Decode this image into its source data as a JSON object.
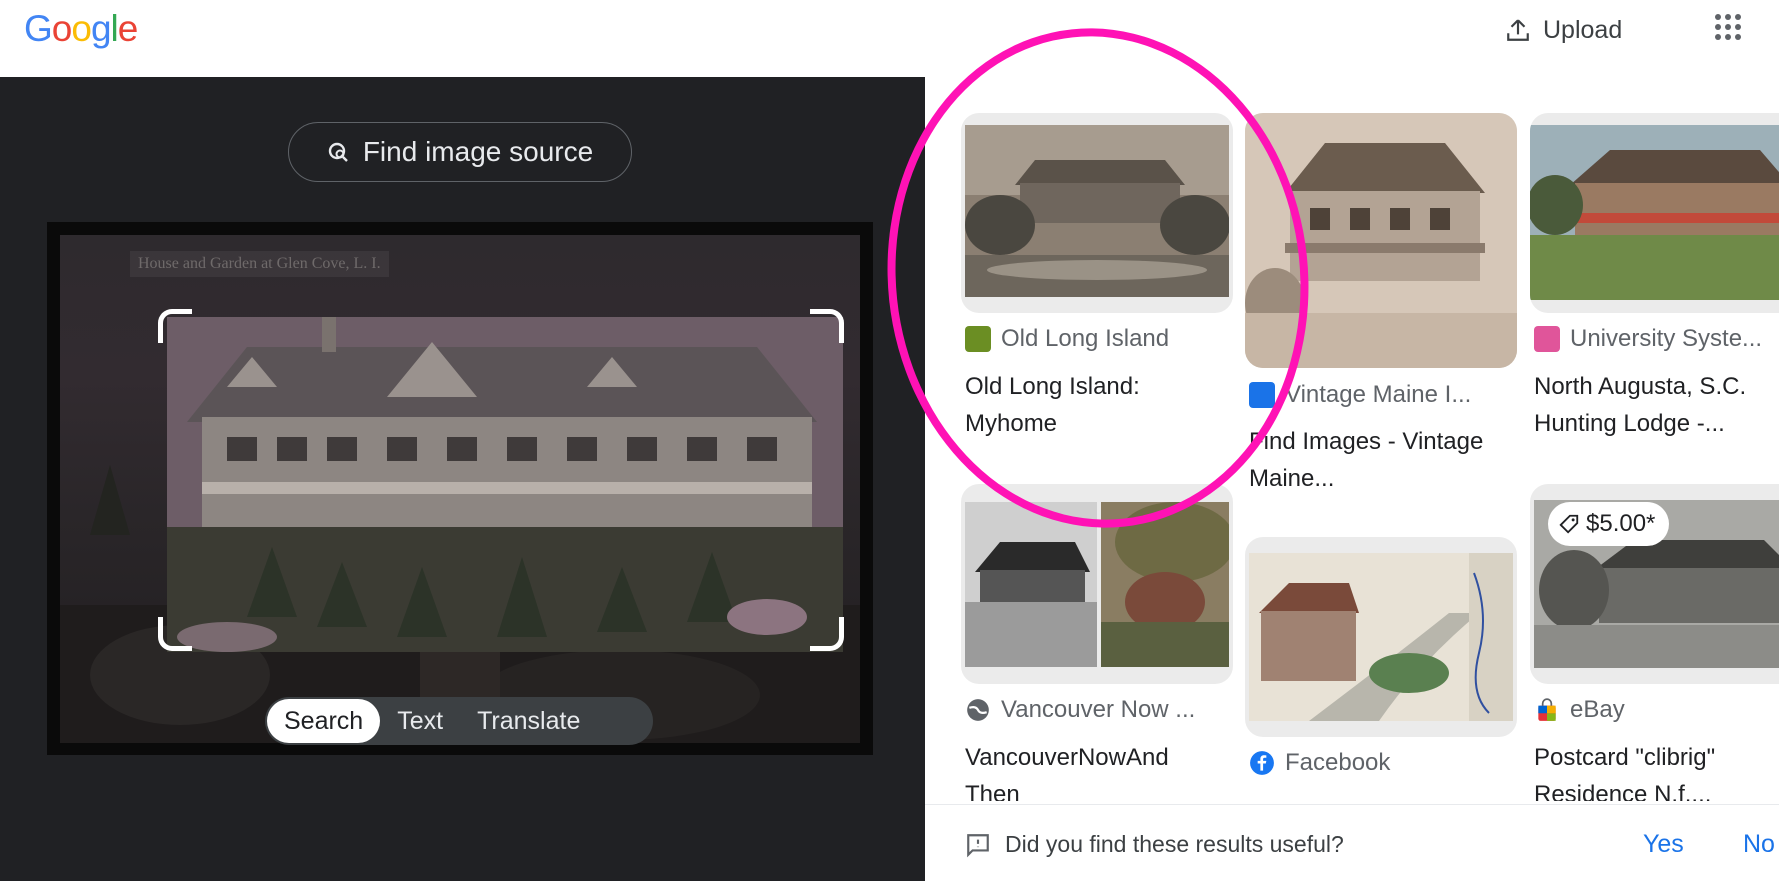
{
  "header": {
    "logo_letters": [
      "G",
      "o",
      "o",
      "g",
      "l",
      "e"
    ],
    "logo_colors": [
      "#4285F4",
      "#EA4335",
      "#FBBC05",
      "#4285F4",
      "#34A853",
      "#EA4335"
    ],
    "upload_label": "Upload"
  },
  "lens": {
    "find_source_label": "Find image source",
    "photo_caption": "House and Garden at Glen Cove, L. I.",
    "tabs": [
      {
        "label": "Search",
        "active": true
      },
      {
        "label": "Text",
        "active": false
      },
      {
        "label": "Translate",
        "active": false
      }
    ]
  },
  "results": [
    {
      "source": "Old Long Island",
      "title": "Old Long Island: Myhome",
      "favicon_color": "#6b8e23"
    },
    {
      "source": "Vintage Maine I...",
      "title": "Find Images - Vintage Maine...",
      "favicon_color": "#1a73e8"
    },
    {
      "source": "University Syste...",
      "title": "North Augusta, S.C. Hunting Lodge -...",
      "favicon_color": "#e0559a"
    },
    {
      "source": "Vancouver Now ...",
      "title": "VancouverNowAnd Then",
      "favicon_color": "#5f6368"
    },
    {
      "source": "Facebook",
      "title": "",
      "favicon_color": "#1877f2"
    },
    {
      "source": "eBay",
      "title": "Postcard \"clibrig\" Residence N.f....",
      "favicon_color": "#e53238",
      "price": "$5.00*"
    }
  ],
  "feedback": {
    "question": "Did you find these results useful?",
    "yes": "Yes",
    "no": "No"
  },
  "colors": {
    "dark_panel": "#202124",
    "link_blue": "#1a73e8",
    "annotation": "#ff12b5"
  }
}
